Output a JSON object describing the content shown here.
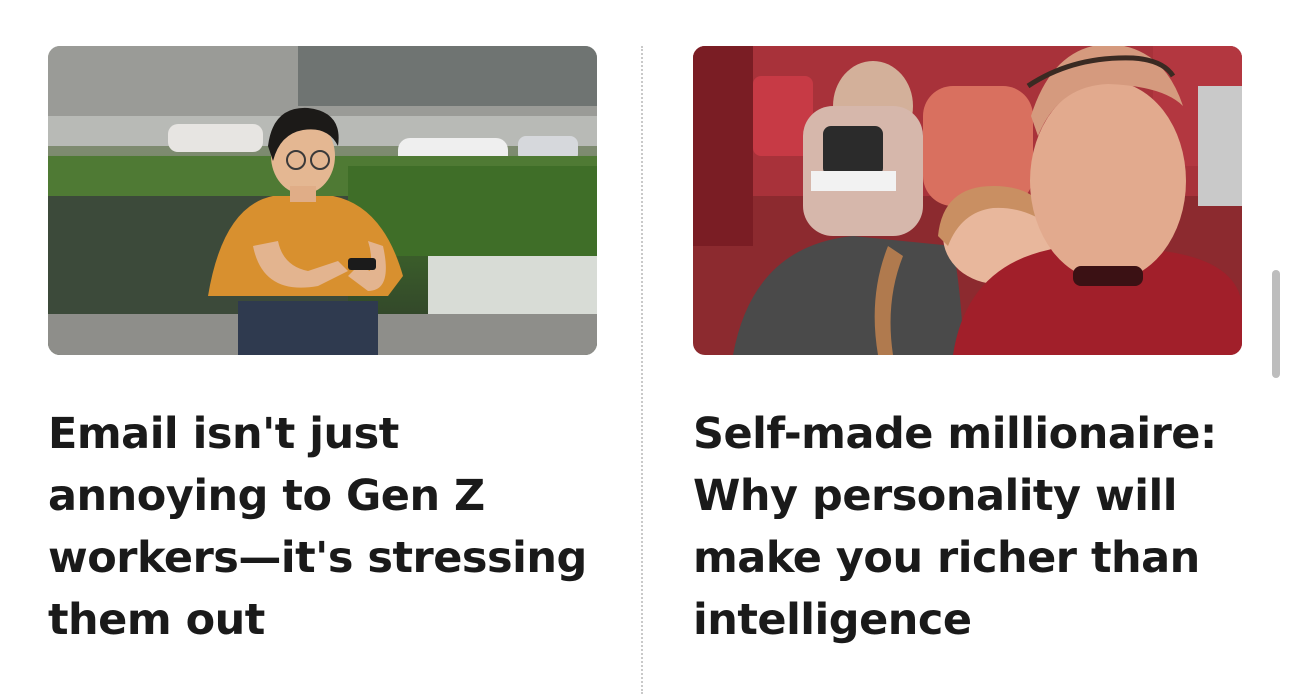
{
  "articles": [
    {
      "headline": "Email isn't just annoying to Gen Z workers—it's stressing them out",
      "image": "woman-using-phone-outdoors-photo"
    },
    {
      "headline": "Self-made millionaire: Why personality will make you richer than intelligence",
      "image": "couple-selfie-stadium-photo"
    }
  ]
}
